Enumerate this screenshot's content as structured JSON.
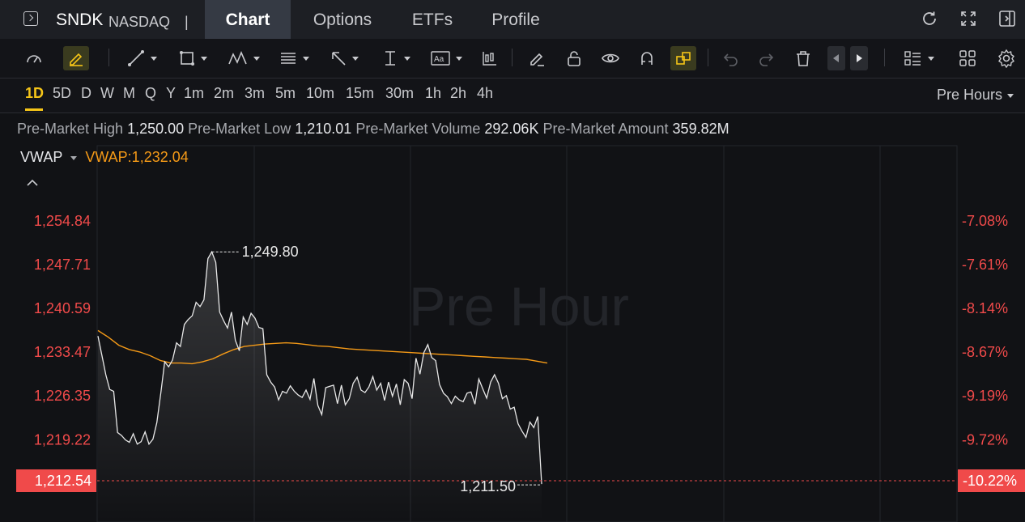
{
  "header": {
    "ticker": "SNDK",
    "exchange": "NASDAQ",
    "separator": "|",
    "tabs": [
      {
        "label": "Chart",
        "active": true
      },
      {
        "label": "Options",
        "active": false
      },
      {
        "label": "ETFs",
        "active": false
      },
      {
        "label": "Profile",
        "active": false
      }
    ]
  },
  "toolbar": {
    "icons": [
      "speedometer-icon",
      "pencil-highlight-icon",
      "line-icon",
      "rectangle-icon",
      "pattern-icon",
      "fibonacci-icon",
      "arrow-icon",
      "text-cursor-icon",
      "text-label-icon",
      "candlestick-icon",
      "eraser-icon",
      "lock-icon",
      "eye-icon",
      "magnet-icon",
      "link-icon",
      "undo-icon",
      "redo-icon",
      "trash-icon",
      "previous-icon",
      "next-icon",
      "layout-list-icon",
      "grid-icon",
      "settings-icon"
    ]
  },
  "periods": {
    "items": [
      "1D",
      "5D",
      "D",
      "W",
      "M",
      "Q",
      "Y",
      "1m",
      "2m",
      "3m",
      "5m",
      "10m",
      "15m",
      "30m",
      "1h",
      "2h",
      "4h"
    ],
    "active": "1D",
    "session": "Pre Hours"
  },
  "stats": {
    "high_label": "Pre-Market High",
    "high": "1,250.00",
    "low_label": "Pre-Market Low",
    "low": "1,210.01",
    "volume_label": "Pre-Market Volume",
    "volume": "292.06K",
    "amount_label": "Pre-Market Amount",
    "amount": "359.82M"
  },
  "indicator": {
    "name": "VWAP",
    "value_text": "VWAP:1,232.04"
  },
  "colors": {
    "price_line": "#e8e8e8",
    "vwap_line": "#f59a17",
    "down": "#f04a4a",
    "accent": "#f5c518"
  },
  "chart_data": {
    "type": "line",
    "watermark": "Pre Hour",
    "left_axis_labels": [
      "1,254.84",
      "1,247.71",
      "1,240.59",
      "1,233.47",
      "1,226.35",
      "1,219.22"
    ],
    "right_axis_labels": [
      "-7.08%",
      "-7.61%",
      "-8.14%",
      "-8.67%",
      "-9.19%",
      "-9.72%"
    ],
    "current_price": "1,212.54",
    "current_change": "-10.22%",
    "high_marker": "1,249.80",
    "low_marker": "1,211.50",
    "ylim": [
      1212.54,
      1254.84
    ],
    "series": [
      {
        "values": [
          1236.1,
          1233.0,
          1229.8,
          1227.4,
          1227.1,
          1220.4,
          1219.9,
          1219.2,
          1218.8,
          1220.2,
          1218.5,
          1218.9,
          1220.5,
          1218.5,
          1219.3,
          1222.0,
          1226.8,
          1231.9,
          1231.1,
          1232.2,
          1235.0,
          1234.4,
          1238.0,
          1238.8,
          1239.4,
          1241.6,
          1240.9,
          1242.0,
          1248.7,
          1249.8,
          1248.1,
          1240.0,
          1238.6,
          1237.4,
          1240.0,
          1235.4,
          1233.7,
          1239.2,
          1238.0,
          1239.8,
          1239.0,
          1237.5,
          1237.3,
          1229.8,
          1228.6,
          1227.8,
          1225.7,
          1227.1,
          1226.8,
          1228.0,
          1227.1,
          1226.5,
          1226.1,
          1227.3,
          1225.8,
          1229.2,
          1224.8,
          1223.3,
          1227.7,
          1227.9,
          1228.1,
          1225.1,
          1228.1,
          1224.9,
          1225.9,
          1228.4,
          1229.4,
          1227.3,
          1226.9,
          1227.8,
          1229.5,
          1227.3,
          1228.4,
          1225.6,
          1228.6,
          1226.3,
          1228.3,
          1224.9,
          1229.0,
          1228.4,
          1225.9,
          1232.5,
          1229.9,
          1233.4,
          1234.7,
          1232.6,
          1232.1,
          1228.2,
          1226.8,
          1226.2,
          1225.1,
          1226.3,
          1225.7,
          1225.4,
          1226.8,
          1227.0,
          1225.0,
          1229.1,
          1227.5,
          1226.0,
          1228.6,
          1229.8,
          1228.4,
          1225.9,
          1226.4,
          1224.2,
          1224.5,
          1221.8,
          1220.6,
          1219.6,
          1222.1,
          1221.2,
          1223.0,
          1212.0
        ],
        "color": "#e8e8e8"
      },
      {
        "values": [
          1237.0,
          1235.9,
          1234.6,
          1233.9,
          1233.5,
          1232.9,
          1232.1,
          1231.7,
          1231.7,
          1231.6,
          1231.9,
          1232.4,
          1233.2,
          1233.9,
          1234.4,
          1234.6,
          1234.8,
          1234.9,
          1235.0,
          1234.9,
          1234.7,
          1234.5,
          1234.4,
          1234.2,
          1234.0,
          1233.9,
          1233.8,
          1233.7,
          1233.6,
          1233.5,
          1233.4,
          1233.3,
          1233.2,
          1233.1,
          1233.0,
          1232.9,
          1232.8,
          1232.7,
          1232.6,
          1232.5,
          1232.4,
          1232.3,
          1232.0,
          1231.7
        ],
        "color": "#f59a17"
      }
    ]
  }
}
